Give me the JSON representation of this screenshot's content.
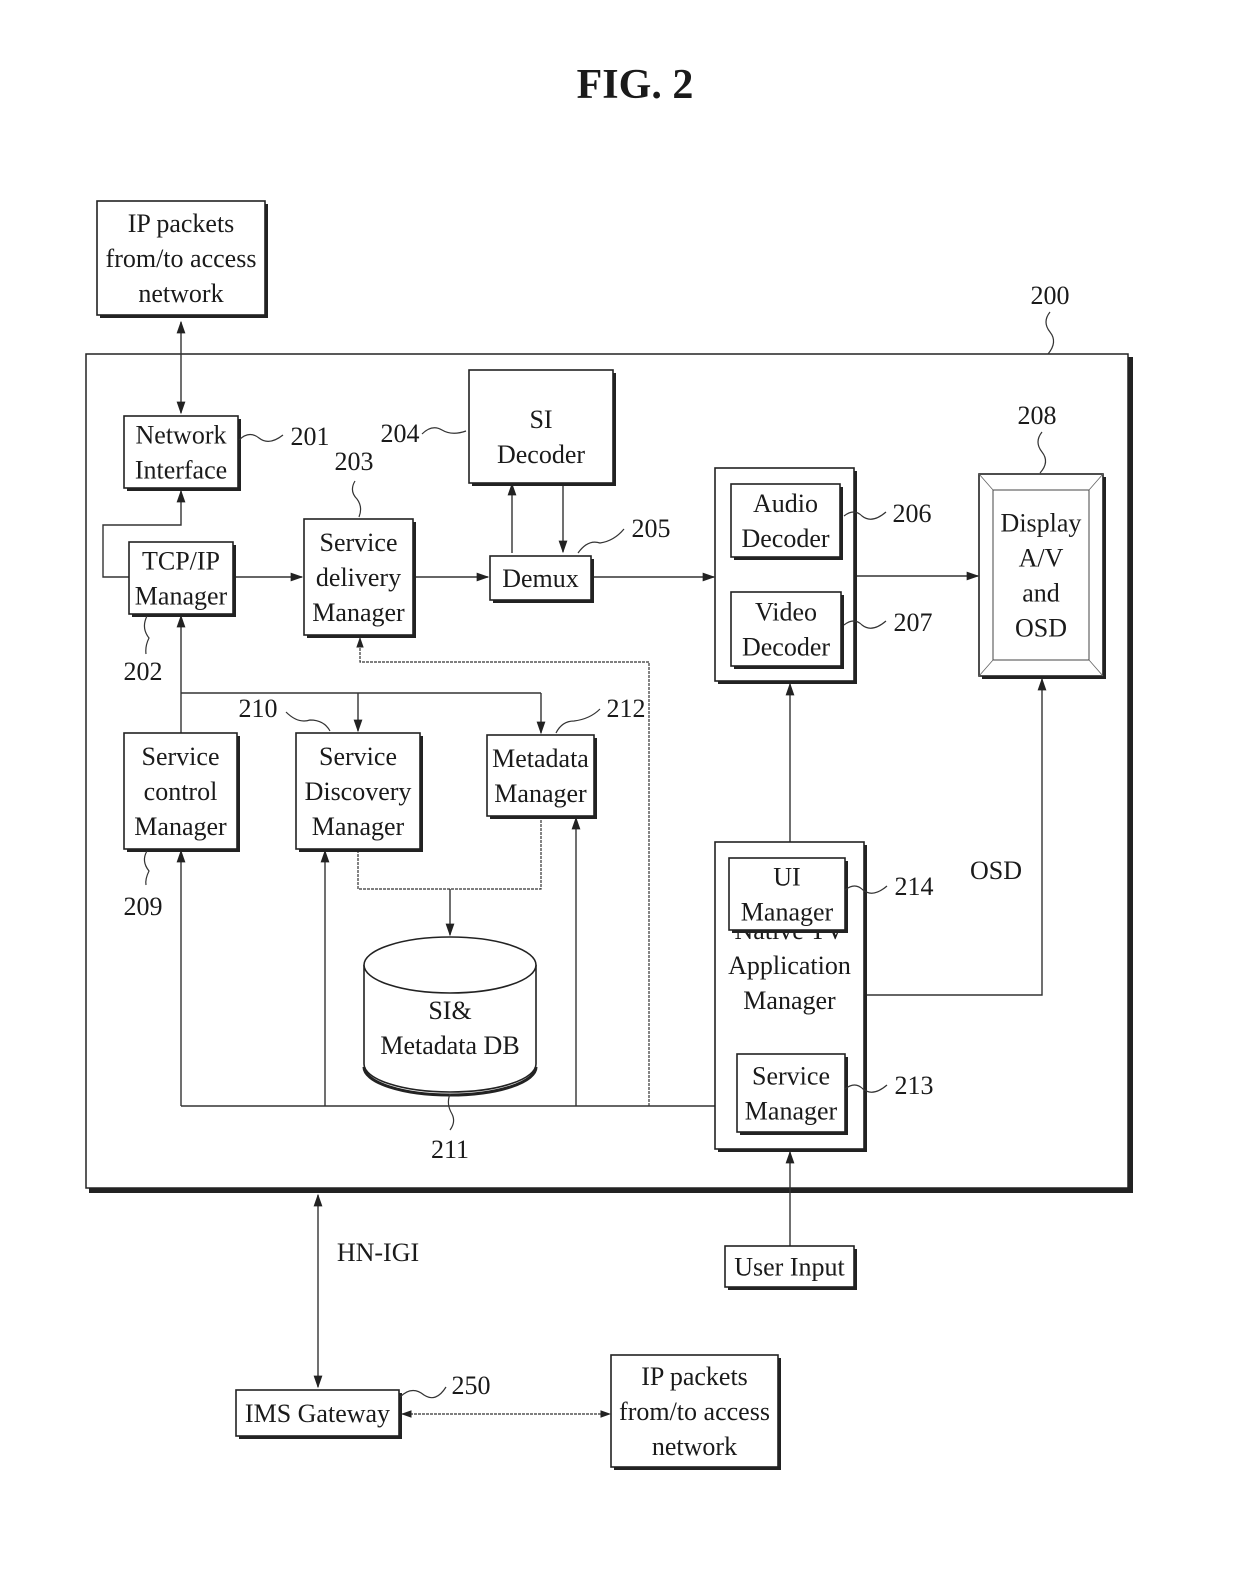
{
  "figure": {
    "title": "FIG. 2"
  },
  "system": {
    "ref": "200"
  },
  "blocks": {
    "ip_top": {
      "lines": [
        "IP packets",
        "from/to access",
        "network"
      ]
    },
    "network_interface": {
      "lines": [
        "Network",
        "Interface"
      ],
      "ref": "201"
    },
    "tcpip_manager": {
      "lines": [
        "TCP/IP",
        "Manager"
      ],
      "ref": "202"
    },
    "service_delivery": {
      "lines": [
        "Service",
        "delivery",
        "Manager"
      ],
      "ref": "203"
    },
    "si_decoder": {
      "lines": [
        "SI",
        "Decoder"
      ],
      "ref": "204"
    },
    "demux": {
      "lines": [
        "Demux"
      ],
      "ref": "205"
    },
    "audio_decoder": {
      "lines": [
        "Audio",
        "Decoder"
      ],
      "ref": "206"
    },
    "video_decoder": {
      "lines": [
        "Video",
        "Decoder"
      ],
      "ref": "207"
    },
    "display": {
      "lines": [
        "Display",
        "A/V",
        "and",
        "OSD"
      ],
      "ref": "208"
    },
    "service_control": {
      "lines": [
        "Service",
        "control",
        "Manager"
      ],
      "ref": "209"
    },
    "service_discovery": {
      "lines": [
        "Service",
        "Discovery",
        "Manager"
      ],
      "ref": "210"
    },
    "si_metadata_db": {
      "lines": [
        "SI&",
        "Metadata DB"
      ],
      "ref": "211"
    },
    "metadata_manager": {
      "lines": [
        "Metadata",
        "Manager"
      ],
      "ref": "212"
    },
    "service_manager": {
      "lines": [
        "Service",
        "Manager"
      ],
      "ref": "213"
    },
    "ui_manager": {
      "lines": [
        "UI",
        "Manager"
      ],
      "ref": "214"
    },
    "native_tv_app": {
      "lines": [
        "Native TV",
        "Application",
        "Manager"
      ]
    },
    "user_input": {
      "lines": [
        "User Input"
      ]
    },
    "ims_gateway": {
      "lines": [
        "IMS Gateway"
      ],
      "ref": "250"
    },
    "ip_bottom": {
      "lines": [
        "IP packets",
        "from/to access",
        "network"
      ]
    }
  },
  "edge_labels": {
    "osd": "OSD",
    "hn_igi": "HN-IGI"
  }
}
